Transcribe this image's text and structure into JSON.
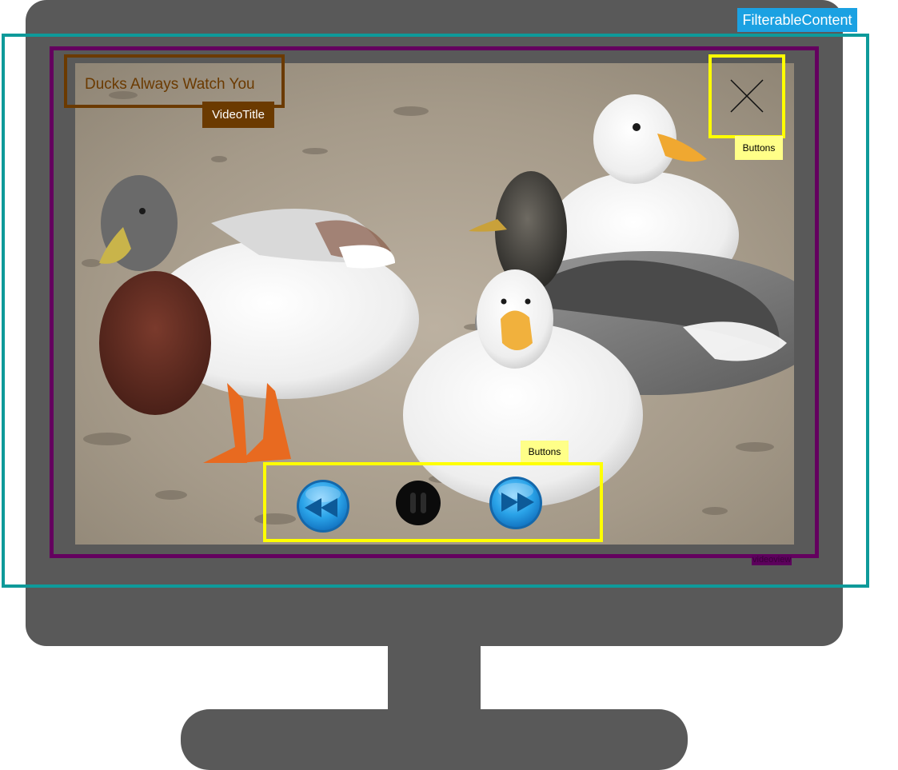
{
  "annotations": {
    "filterable_content": "FilterableContent",
    "videoview": "videoview",
    "video_title_tag": "VideoTitle",
    "buttons_top": "Buttons",
    "buttons_bottom": "Buttons"
  },
  "video": {
    "title": "Ducks Always Watch You"
  },
  "controls": {
    "rewind_icon": "rewind-icon",
    "pause_icon": "pause-icon",
    "forward_icon": "fast-forward-icon",
    "close_icon": "close-icon"
  },
  "colors": {
    "monitor": "#595959",
    "filterable_frame": "#0e9a9a",
    "filterable_tag_bg": "#1ba1e2",
    "videoview_frame": "#64005f",
    "title_frame": "#6b3a00",
    "buttons_frame": "#ffff00",
    "buttons_tag_bg": "#ffff88",
    "control_blue": "#2aa3e8"
  }
}
